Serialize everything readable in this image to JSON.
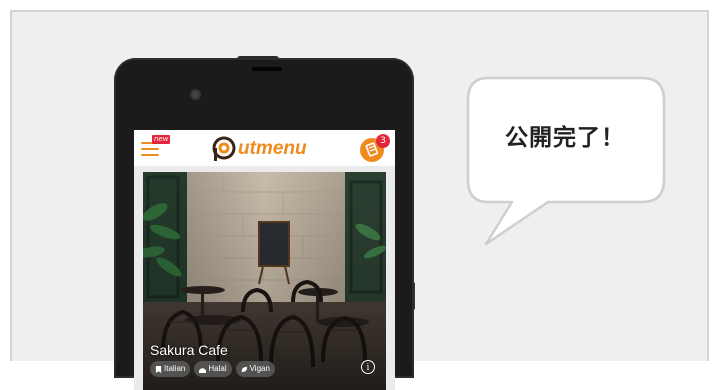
{
  "app": {
    "new_badge": "new",
    "logo_text": "utmenu",
    "cart_count": "3"
  },
  "card": {
    "name": "Sakura Cafe",
    "tags": [
      "Italian",
      "Halal",
      "Vigan"
    ],
    "info_glyph": "i"
  },
  "bubble": {
    "text": "公開完了！"
  },
  "colors": {
    "brand_orange": "#f08a1f",
    "badge_red": "#e3263b",
    "logo_dark": "#3a2416"
  }
}
